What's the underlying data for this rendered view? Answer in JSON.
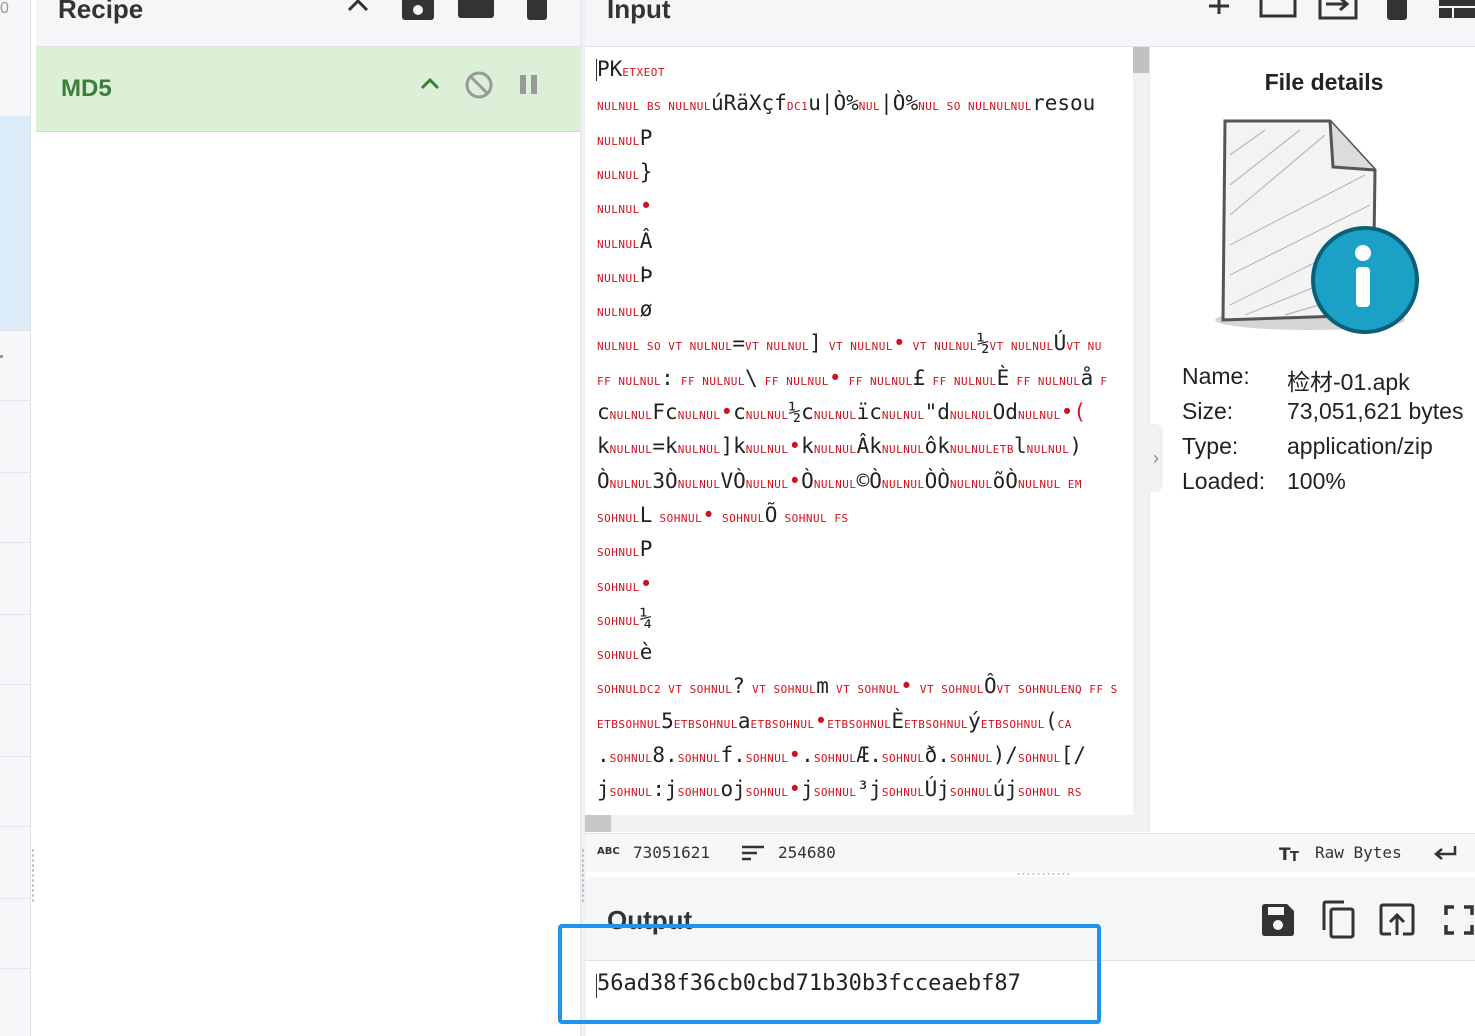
{
  "recipe": {
    "title": "Recipe",
    "operation": {
      "name": "MD5"
    }
  },
  "input": {
    "title": "Input",
    "lines": [
      {
        "t": [
          [
            "PK",
            "t"
          ],
          [
            "ETXEOT",
            "c"
          ]
        ]
      },
      {
        "t": [
          [
            "NULNUL BS NULNUL",
            "c"
          ],
          [
            "úRäXçf",
            "t"
          ],
          [
            "DC1",
            "c"
          ],
          [
            "u|Ò%",
            "t"
          ],
          [
            "NUL",
            "c"
          ],
          [
            "|Ò%",
            "t"
          ],
          [
            "NUL SO NULNULNUL",
            "c"
          ],
          [
            "resou",
            "t"
          ]
        ]
      },
      {
        "t": [
          [
            "NULNUL",
            "c"
          ],
          [
            "P",
            "t"
          ]
        ]
      },
      {
        "t": [
          [
            "NULNUL",
            "c"
          ],
          [
            "}",
            "t"
          ]
        ]
      },
      {
        "t": [
          [
            "NULNUL",
            "c"
          ],
          [
            "•",
            "d"
          ]
        ]
      },
      {
        "t": [
          [
            "NULNUL",
            "c"
          ],
          [
            "Â",
            "t"
          ]
        ]
      },
      {
        "t": [
          [
            "NULNUL",
            "c"
          ],
          [
            "Þ",
            "t"
          ]
        ]
      },
      {
        "t": [
          [
            "NULNUL",
            "c"
          ],
          [
            "ø",
            "t"
          ]
        ]
      },
      {
        "t": [
          [
            "NULNUL SO  VT NULNUL",
            "c"
          ],
          [
            "=",
            "t"
          ],
          [
            "VT NULNUL",
            "c"
          ],
          [
            "]",
            "t"
          ],
          [
            " VT NULNUL",
            "c"
          ],
          [
            "•",
            "d"
          ],
          [
            " VT NULNUL",
            "c"
          ],
          [
            "½",
            "t"
          ],
          [
            "VT NULNUL",
            "c"
          ],
          [
            "Ú",
            "t"
          ],
          [
            "VT NU",
            "c"
          ]
        ]
      },
      {
        "t": [
          [
            " FF NULNUL",
            "c"
          ],
          [
            ":",
            "t"
          ],
          [
            " FF NULNUL",
            "c"
          ],
          [
            "\\",
            "t"
          ],
          [
            " FF NULNUL",
            "c"
          ],
          [
            "•",
            "d"
          ],
          [
            " FF NULNUL",
            "c"
          ],
          [
            "£",
            "t"
          ],
          [
            " FF NULNUL",
            "c"
          ],
          [
            "È",
            "t"
          ],
          [
            " FF NULNUL",
            "c"
          ],
          [
            "å",
            "t"
          ],
          [
            " F",
            "c"
          ]
        ]
      },
      {
        "t": [
          [
            "c",
            "t"
          ],
          [
            "NULNUL",
            "c"
          ],
          [
            "Fc",
            "t"
          ],
          [
            "NULNUL",
            "c"
          ],
          [
            "•",
            "d"
          ],
          [
            "c",
            "t"
          ],
          [
            "NULNUL",
            "c"
          ],
          [
            "½c",
            "t"
          ],
          [
            "NULNUL",
            "c"
          ],
          [
            "ïc",
            "t"
          ],
          [
            "NULNUL",
            "c"
          ],
          [
            "\"d",
            "t"
          ],
          [
            "NULNUL",
            "c"
          ],
          [
            "Od",
            "t"
          ],
          [
            "NULNUL",
            "c"
          ],
          [
            "•(",
            "d"
          ]
        ]
      },
      {
        "t": [
          [
            "k",
            "t"
          ],
          [
            "NULNUL",
            "c"
          ],
          [
            "=k",
            "t"
          ],
          [
            "NULNUL",
            "c"
          ],
          [
            "]k",
            "t"
          ],
          [
            "NULNUL",
            "c"
          ],
          [
            "•",
            "d"
          ],
          [
            "k",
            "t"
          ],
          [
            "NULNUL",
            "c"
          ],
          [
            "Âk",
            "t"
          ],
          [
            "NULNUL",
            "c"
          ],
          [
            "ôk",
            "t"
          ],
          [
            "NULNULETB",
            "c"
          ],
          [
            "l",
            "t"
          ],
          [
            "NULNUL",
            "c"
          ],
          [
            ")",
            "t"
          ]
        ]
      },
      {
        "t": [
          [
            "Ò",
            "t"
          ],
          [
            "NULNUL",
            "c"
          ],
          [
            "3Ò",
            "t"
          ],
          [
            "NULNUL",
            "c"
          ],
          [
            "VÒ",
            "t"
          ],
          [
            "NULNUL",
            "c"
          ],
          [
            "•",
            "d"
          ],
          [
            "Ò",
            "t"
          ],
          [
            "NULNUL",
            "c"
          ],
          [
            "©Ò",
            "t"
          ],
          [
            "NULNUL",
            "c"
          ],
          [
            "ÒÒ",
            "t"
          ],
          [
            "NULNUL",
            "c"
          ],
          [
            "õÒ",
            "t"
          ],
          [
            "NULNUL EM",
            "c"
          ]
        ]
      },
      {
        "t": [
          [
            "      SOHNUL",
            "c"
          ],
          [
            "L",
            "t"
          ],
          [
            "      SOHNUL",
            "c"
          ],
          [
            "•",
            "d"
          ],
          [
            "      SOHNUL",
            "c"
          ],
          [
            "Õ",
            "t"
          ],
          [
            "      SOHNUL FS",
            "c"
          ]
        ]
      },
      {
        "t": [
          [
            "SOHNUL",
            "c"
          ],
          [
            "P",
            "t"
          ]
        ]
      },
      {
        "t": [
          [
            "SOHNUL",
            "c"
          ],
          [
            "•",
            "d"
          ]
        ]
      },
      {
        "t": [
          [
            "SOHNUL",
            "c"
          ],
          [
            "¼",
            "t"
          ]
        ]
      },
      {
        "t": [
          [
            "SOHNUL",
            "c"
          ],
          [
            "è",
            "t"
          ]
        ]
      },
      {
        "t": [
          [
            "SOHNULDC2 VT SOHNUL",
            "c"
          ],
          [
            "?",
            "t"
          ],
          [
            " VT SOHNUL",
            "c"
          ],
          [
            "m",
            "t"
          ],
          [
            " VT SOHNUL",
            "c"
          ],
          [
            "•",
            "d"
          ],
          [
            " VT SOHNUL",
            "c"
          ],
          [
            "Ô",
            "t"
          ],
          [
            "VT SOHNULENQ FF S",
            "c"
          ]
        ]
      },
      {
        "t": [
          [
            "ETBSOHNUL",
            "c"
          ],
          [
            "5",
            "t"
          ],
          [
            "ETBSOHNUL",
            "c"
          ],
          [
            "a",
            "t"
          ],
          [
            "ETBSOHNUL",
            "c"
          ],
          [
            "•",
            "d"
          ],
          [
            "ETBSOHNUL",
            "c"
          ],
          [
            "È",
            "t"
          ],
          [
            "ETBSOHNUL",
            "c"
          ],
          [
            "ý",
            "t"
          ],
          [
            "ETBSOHNUL",
            "c"
          ],
          [
            "(",
            "t"
          ],
          [
            "CA",
            "c"
          ]
        ]
      },
      {
        "t": [
          [
            ".",
            "t"
          ],
          [
            "SOHNUL",
            "c"
          ],
          [
            "8.",
            "t"
          ],
          [
            "SOHNUL",
            "c"
          ],
          [
            "f.",
            "t"
          ],
          [
            "SOHNUL",
            "c"
          ],
          [
            "•",
            "d"
          ],
          [
            ".",
            "t"
          ],
          [
            "SOHNUL",
            "c"
          ],
          [
            "Æ.",
            "t"
          ],
          [
            "SOHNUL",
            "c"
          ],
          [
            "ð.",
            "t"
          ],
          [
            "SOHNUL",
            "c"
          ],
          [
            ")/",
            "t"
          ],
          [
            "SOHNUL",
            "c"
          ],
          [
            "[/",
            "t"
          ]
        ]
      },
      {
        "t": [
          [
            "j",
            "t"
          ],
          [
            "SOHNUL",
            "c"
          ],
          [
            ":j",
            "t"
          ],
          [
            "SOHNUL",
            "c"
          ],
          [
            "oj",
            "t"
          ],
          [
            "SOHNUL",
            "c"
          ],
          [
            "•",
            "d"
          ],
          [
            "j",
            "t"
          ],
          [
            "SOHNUL",
            "c"
          ],
          [
            "³j",
            "t"
          ],
          [
            "SOHNUL",
            "c"
          ],
          [
            "Új",
            "t"
          ],
          [
            "SOHNUL",
            "c"
          ],
          [
            "új",
            "t"
          ],
          [
            "SOHNUL RS",
            "c"
          ]
        ]
      }
    ],
    "status": {
      "length": "73051621",
      "lines": "254680",
      "encoding": "Raw Bytes"
    }
  },
  "file_details": {
    "title": "File details",
    "rows": [
      {
        "key": "Name:",
        "value": "检材-01.apk"
      },
      {
        "key": "Size:",
        "value": "73,051,621 bytes"
      },
      {
        "key": "Type:",
        "value": "application/zip"
      },
      {
        "key": "Loaded:",
        "value": "100%"
      }
    ]
  },
  "output": {
    "title": "Output",
    "value": "56ad38f36cb0cbd71b30b3fcceaebf87"
  },
  "colors": {
    "accent_highlight": "#1a95f0",
    "op_bg": "#dcefd7",
    "op_text": "#3b7f3b",
    "control_char": "#d0121b",
    "info_badge": "#1ba0c6"
  },
  "icons": {
    "recipe": [
      "chevron-up-icon",
      "save-icon",
      "folder-icon",
      "trash-icon"
    ],
    "operation": [
      "chevron-up-icon",
      "disable-icon",
      "pause-icon"
    ],
    "input": [
      "plus-icon",
      "new-tab-icon",
      "open-file-icon",
      "trash-icon",
      "layout-icon"
    ],
    "output": [
      "save-icon",
      "copy-icon",
      "replace-input-icon",
      "fullscreen-icon"
    ]
  }
}
